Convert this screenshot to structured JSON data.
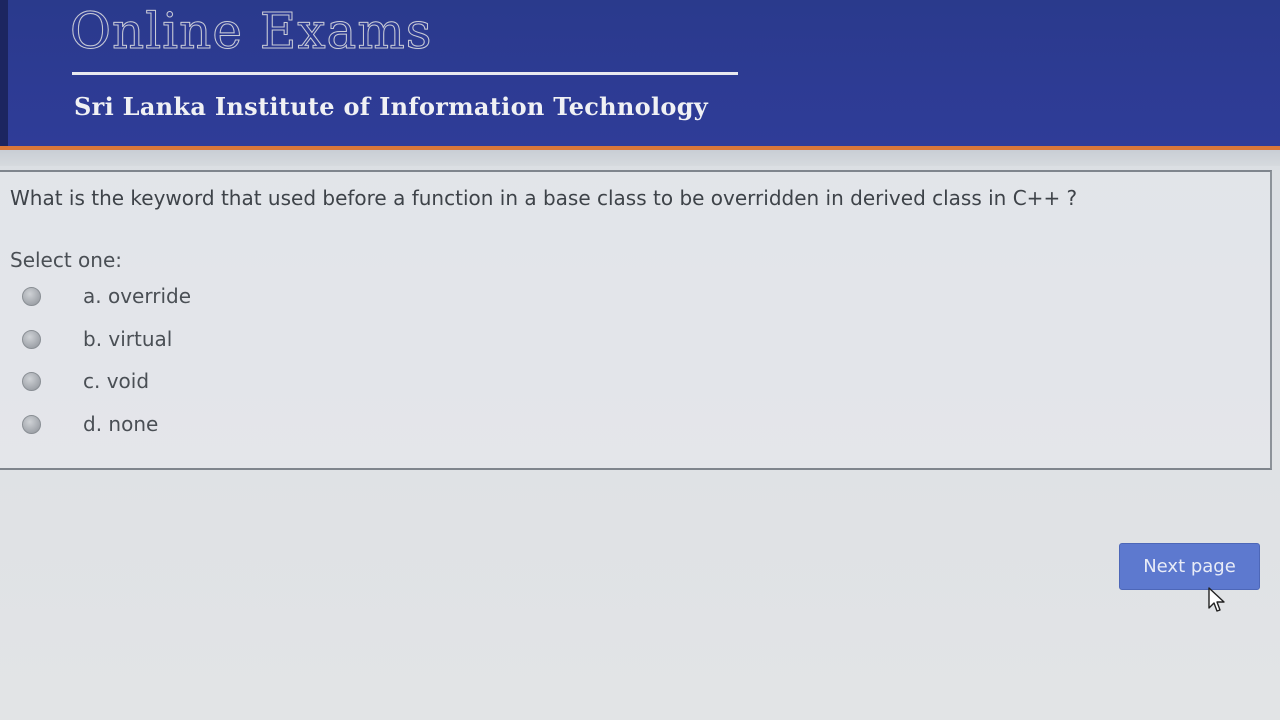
{
  "header": {
    "title": "Online Exams",
    "subtitle": "Sri Lanka Institute of Information Technology"
  },
  "question": {
    "text": "What is the keyword that used before a function in a base class to be overridden in derived class in C++ ?",
    "prompt": "Select one:",
    "options": [
      {
        "label": "a. override"
      },
      {
        "label": "b. virtual"
      },
      {
        "label": "c. void"
      },
      {
        "label": "d. none"
      }
    ]
  },
  "navigation": {
    "next_label": "Next page"
  },
  "colors": {
    "header_bg": "#2d3b93",
    "accent_orange": "#d9773a",
    "button_bg": "#5d79cf"
  },
  "icons": {
    "cursor": "mouse-pointer-icon"
  }
}
